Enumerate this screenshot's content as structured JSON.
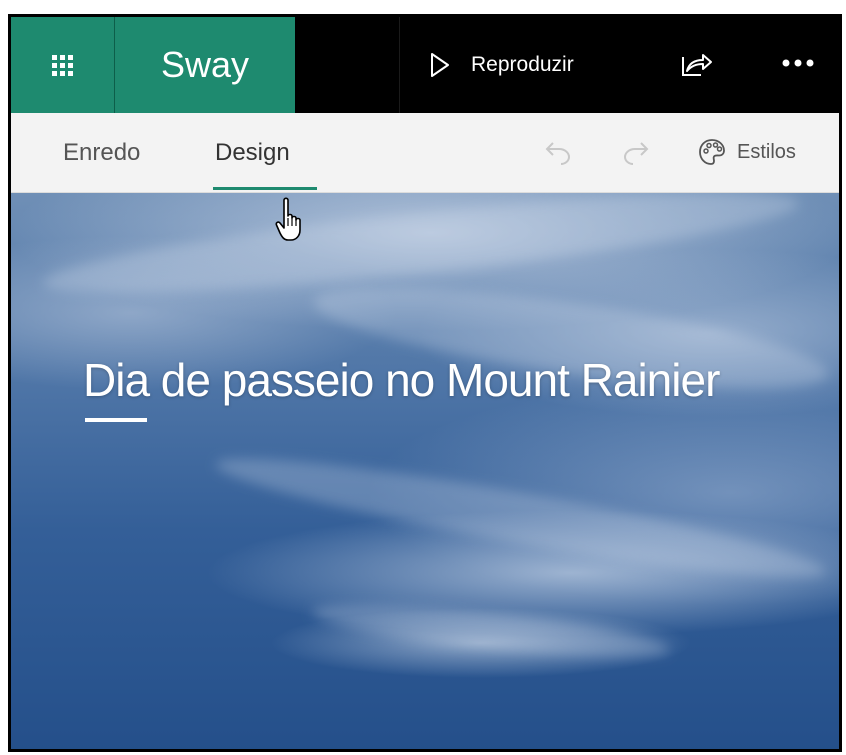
{
  "app": {
    "name": "Sway",
    "accent_color": "#1e8a6f"
  },
  "toolbar": {
    "apps_icon": "waffle-grid-icon",
    "play_label": "Reproduzir",
    "play_icon": "play-icon",
    "share_icon": "share-icon",
    "more_icon": "more-icon"
  },
  "tabs": [
    {
      "label": "Enredo",
      "active": false
    },
    {
      "label": "Design",
      "active": true
    }
  ],
  "actions": {
    "undo_icon": "undo-icon",
    "redo_icon": "redo-icon",
    "styles_icon": "palette-icon",
    "styles_label": "Estilos"
  },
  "canvas": {
    "title": "Dia de passeio no Mount Rainier",
    "background": "sky-with-clouds"
  }
}
